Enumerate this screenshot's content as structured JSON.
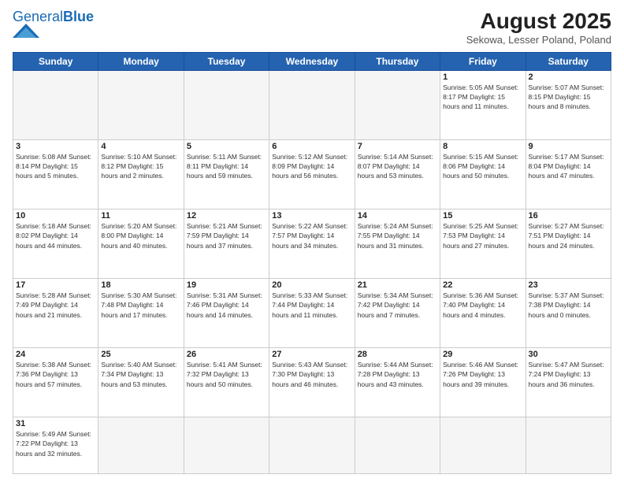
{
  "header": {
    "logo_text_general": "General",
    "logo_text_blue": "Blue",
    "main_title": "August 2025",
    "subtitle": "Sekowa, Lesser Poland, Poland"
  },
  "weekdays": [
    "Sunday",
    "Monday",
    "Tuesday",
    "Wednesday",
    "Thursday",
    "Friday",
    "Saturday"
  ],
  "weeks": [
    [
      {
        "day": "",
        "info": ""
      },
      {
        "day": "",
        "info": ""
      },
      {
        "day": "",
        "info": ""
      },
      {
        "day": "",
        "info": ""
      },
      {
        "day": "",
        "info": ""
      },
      {
        "day": "1",
        "info": "Sunrise: 5:05 AM\nSunset: 8:17 PM\nDaylight: 15 hours\nand 11 minutes."
      },
      {
        "day": "2",
        "info": "Sunrise: 5:07 AM\nSunset: 8:15 PM\nDaylight: 15 hours\nand 8 minutes."
      }
    ],
    [
      {
        "day": "3",
        "info": "Sunrise: 5:08 AM\nSunset: 8:14 PM\nDaylight: 15 hours\nand 5 minutes."
      },
      {
        "day": "4",
        "info": "Sunrise: 5:10 AM\nSunset: 8:12 PM\nDaylight: 15 hours\nand 2 minutes."
      },
      {
        "day": "5",
        "info": "Sunrise: 5:11 AM\nSunset: 8:11 PM\nDaylight: 14 hours\nand 59 minutes."
      },
      {
        "day": "6",
        "info": "Sunrise: 5:12 AM\nSunset: 8:09 PM\nDaylight: 14 hours\nand 56 minutes."
      },
      {
        "day": "7",
        "info": "Sunrise: 5:14 AM\nSunset: 8:07 PM\nDaylight: 14 hours\nand 53 minutes."
      },
      {
        "day": "8",
        "info": "Sunrise: 5:15 AM\nSunset: 8:06 PM\nDaylight: 14 hours\nand 50 minutes."
      },
      {
        "day": "9",
        "info": "Sunrise: 5:17 AM\nSunset: 8:04 PM\nDaylight: 14 hours\nand 47 minutes."
      }
    ],
    [
      {
        "day": "10",
        "info": "Sunrise: 5:18 AM\nSunset: 8:02 PM\nDaylight: 14 hours\nand 44 minutes."
      },
      {
        "day": "11",
        "info": "Sunrise: 5:20 AM\nSunset: 8:00 PM\nDaylight: 14 hours\nand 40 minutes."
      },
      {
        "day": "12",
        "info": "Sunrise: 5:21 AM\nSunset: 7:59 PM\nDaylight: 14 hours\nand 37 minutes."
      },
      {
        "day": "13",
        "info": "Sunrise: 5:22 AM\nSunset: 7:57 PM\nDaylight: 14 hours\nand 34 minutes."
      },
      {
        "day": "14",
        "info": "Sunrise: 5:24 AM\nSunset: 7:55 PM\nDaylight: 14 hours\nand 31 minutes."
      },
      {
        "day": "15",
        "info": "Sunrise: 5:25 AM\nSunset: 7:53 PM\nDaylight: 14 hours\nand 27 minutes."
      },
      {
        "day": "16",
        "info": "Sunrise: 5:27 AM\nSunset: 7:51 PM\nDaylight: 14 hours\nand 24 minutes."
      }
    ],
    [
      {
        "day": "17",
        "info": "Sunrise: 5:28 AM\nSunset: 7:49 PM\nDaylight: 14 hours\nand 21 minutes."
      },
      {
        "day": "18",
        "info": "Sunrise: 5:30 AM\nSunset: 7:48 PM\nDaylight: 14 hours\nand 17 minutes."
      },
      {
        "day": "19",
        "info": "Sunrise: 5:31 AM\nSunset: 7:46 PM\nDaylight: 14 hours\nand 14 minutes."
      },
      {
        "day": "20",
        "info": "Sunrise: 5:33 AM\nSunset: 7:44 PM\nDaylight: 14 hours\nand 11 minutes."
      },
      {
        "day": "21",
        "info": "Sunrise: 5:34 AM\nSunset: 7:42 PM\nDaylight: 14 hours\nand 7 minutes."
      },
      {
        "day": "22",
        "info": "Sunrise: 5:36 AM\nSunset: 7:40 PM\nDaylight: 14 hours\nand 4 minutes."
      },
      {
        "day": "23",
        "info": "Sunrise: 5:37 AM\nSunset: 7:38 PM\nDaylight: 14 hours\nand 0 minutes."
      }
    ],
    [
      {
        "day": "24",
        "info": "Sunrise: 5:38 AM\nSunset: 7:36 PM\nDaylight: 13 hours\nand 57 minutes."
      },
      {
        "day": "25",
        "info": "Sunrise: 5:40 AM\nSunset: 7:34 PM\nDaylight: 13 hours\nand 53 minutes."
      },
      {
        "day": "26",
        "info": "Sunrise: 5:41 AM\nSunset: 7:32 PM\nDaylight: 13 hours\nand 50 minutes."
      },
      {
        "day": "27",
        "info": "Sunrise: 5:43 AM\nSunset: 7:30 PM\nDaylight: 13 hours\nand 46 minutes."
      },
      {
        "day": "28",
        "info": "Sunrise: 5:44 AM\nSunset: 7:28 PM\nDaylight: 13 hours\nand 43 minutes."
      },
      {
        "day": "29",
        "info": "Sunrise: 5:46 AM\nSunset: 7:26 PM\nDaylight: 13 hours\nand 39 minutes."
      },
      {
        "day": "30",
        "info": "Sunrise: 5:47 AM\nSunset: 7:24 PM\nDaylight: 13 hours\nand 36 minutes."
      }
    ],
    [
      {
        "day": "31",
        "info": "Sunrise: 5:49 AM\nSunset: 7:22 PM\nDaylight: 13 hours\nand 32 minutes."
      },
      {
        "day": "",
        "info": ""
      },
      {
        "day": "",
        "info": ""
      },
      {
        "day": "",
        "info": ""
      },
      {
        "day": "",
        "info": ""
      },
      {
        "day": "",
        "info": ""
      },
      {
        "day": "",
        "info": ""
      }
    ]
  ]
}
